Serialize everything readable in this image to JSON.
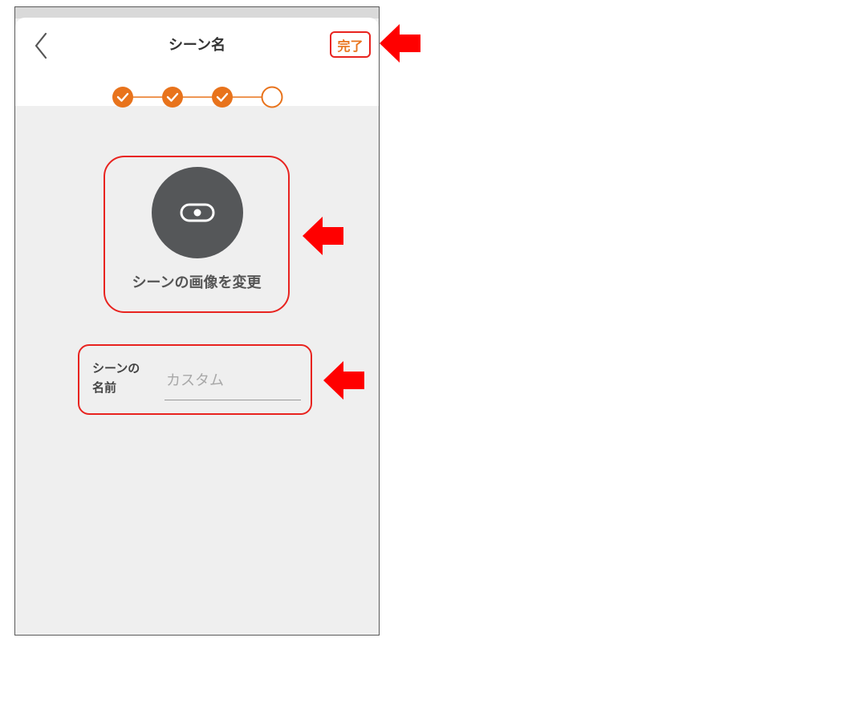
{
  "header": {
    "title": "シーン名",
    "done_label": "完了"
  },
  "stepper": {
    "total_steps": 4,
    "completed_steps": 3
  },
  "scene_image": {
    "change_label": "シーンの画像を変更"
  },
  "scene_name": {
    "label_line1": "シーンの",
    "label_line2": "名前",
    "placeholder": "カスタム",
    "value": ""
  },
  "colors": {
    "accent": "#e8731c",
    "highlight": "#e8231f",
    "annotation_arrow": "#ff0000",
    "avatar_bg": "#555759",
    "page_bg": "#efefef"
  },
  "icons": {
    "back": "chevron-left-icon",
    "step_done": "check-circle-icon",
    "step_pending": "empty-circle-icon",
    "scene": "toggle-switch-icon",
    "annotation": "left-arrow-icon"
  }
}
